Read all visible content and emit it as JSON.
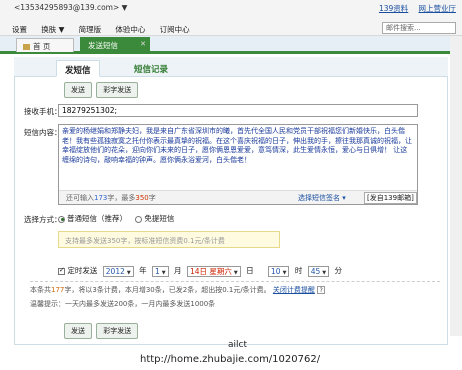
{
  "topbar": {
    "account": "<13534295893@139.com> ▼",
    "links": [
      "139资料",
      "网上营业厅"
    ],
    "menu": [
      "设置",
      "换肤 ▼",
      "简理版",
      "体验中心",
      "订阅中心"
    ],
    "search_placeholder": "邮件搜索..."
  },
  "tabs": {
    "home": "首 页",
    "sms": "发送短信",
    "close": "✕"
  },
  "subtabs": {
    "send": "发短信",
    "records": "短信记录"
  },
  "buttons": {
    "send": "发送",
    "mms": "彩字发送"
  },
  "recipient": {
    "label": "接收手机：",
    "value": "18279251302;"
  },
  "content": {
    "label": "短信内容：",
    "text": "亲爱的杨继娟和郑静夫妇，我是来自广东省深圳市的曦，首先代全国人民和党员干部祝福您们新婚快乐，白头偕老！我有些孤独寂寞之托付你表示最真挚的祝福。在这个喜庆祝福的日子，伸出我的手，擦往我那真诚的祝福，让幸福绽放他们的花朵，迎向你们未来的日子，愿你俩恩恩爱爱，意笃情深，此生爱情永恒，爱心与日俱增！ 让这缠绵的诗句，敲响幸福的钟声。愿你俩永浴爱河，白头偕老！",
    "count_prefix": "还可输入",
    "count_remaining": "173",
    "count_mid": "字，最多",
    "count_max": "350",
    "count_suffix": "字",
    "choose_sign": "选择短信签名 ▾",
    "send_from": "[发自139邮箱]"
  },
  "options": {
    "label": "选择方式：",
    "normal": "普通短信（推荐）",
    "free": "免提短信",
    "hint": "支持最多发送350字，按标准短信资费0.1元/条计费"
  },
  "schedule": {
    "label": "定时发送",
    "year": "2012",
    "year_unit": "年",
    "month": "1",
    "month_unit": "月",
    "day": "14日 星期六",
    "day_unit": "日",
    "hour": "10",
    "hour_unit": "时",
    "minute": "45",
    "minute_unit": "分"
  },
  "info": {
    "text1": "本条共",
    "chars": "177",
    "text2": "字，将以3条计费，本月增30条，已发2条，超出按0.1元/条计费。",
    "link": "关闭计费提醒",
    "q": "?",
    "tip": "温馨提示：一天内最多发送200条，一月内最多发送1000条"
  },
  "watermark": {
    "line1": "ailct",
    "line2": "http://home.zhubajie.com/1020762/"
  }
}
